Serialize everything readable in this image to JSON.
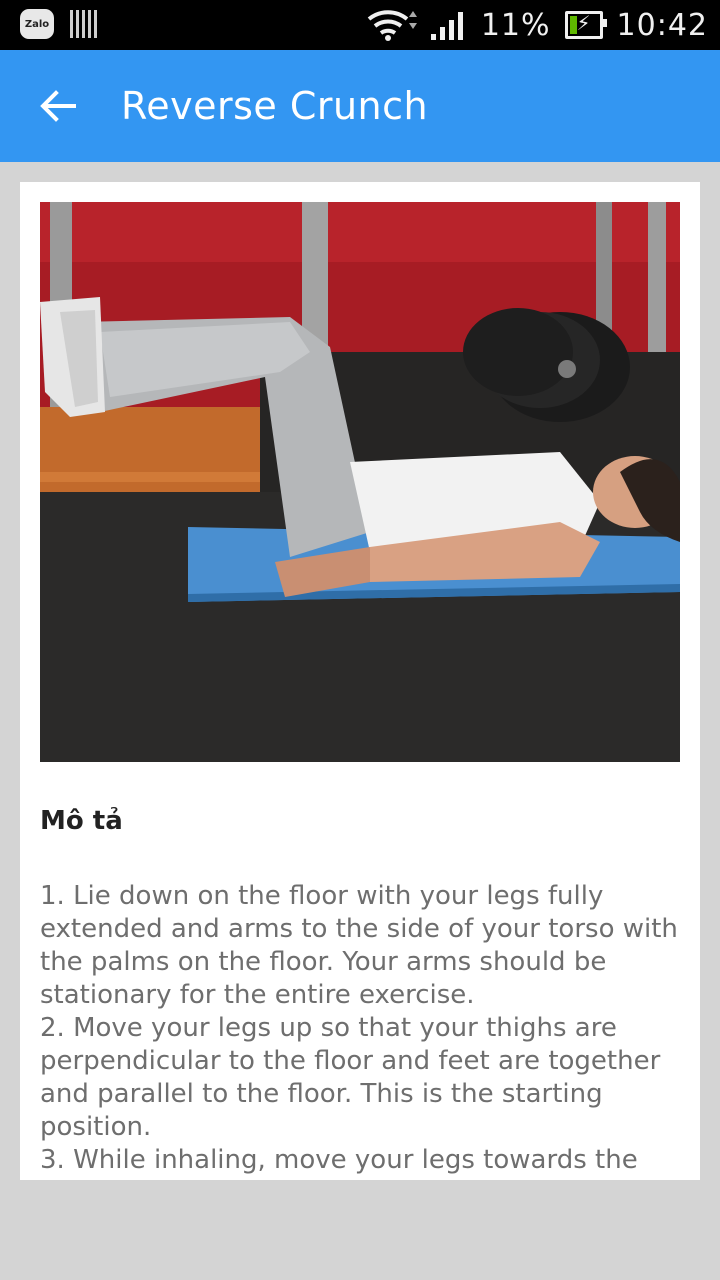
{
  "status_bar": {
    "zalo_label": "Zalo",
    "battery": "11%",
    "time": "10:42",
    "icons": [
      "zalo-icon",
      "notification-bars-icon",
      "wifi-icon",
      "signal-icon",
      "battery-charging-icon"
    ]
  },
  "app_bar": {
    "title": "Reverse Crunch",
    "back_icon": "arrow-left-icon",
    "color": "#3396f2"
  },
  "exercise": {
    "image": "reverse-crunch-photo",
    "section_title": "Mô tả",
    "steps": [
      " 1. Lie down on the floor with your legs fully extended and arms to the side of your torso with the palms on the floor. Your arms should be stationary for the entire exercise.",
      " 2. Move your legs up so that your thighs are perpendicular to the floor and feet are together and parallel to the floor. This is the starting position.",
      " 3. While inhaling, move your legs towards the"
    ]
  }
}
